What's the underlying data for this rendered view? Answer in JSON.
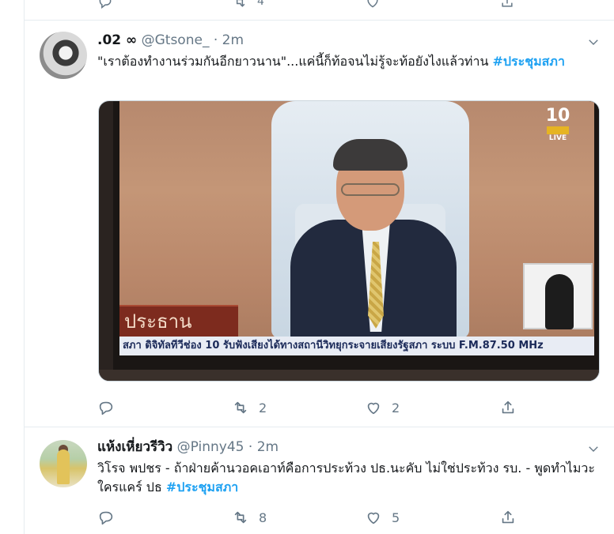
{
  "previous_tweet": {
    "retweet_count": "4"
  },
  "tweets": [
    {
      "display_name": ".02 ∞",
      "handle": "@Gtsone_",
      "separator": "·",
      "time": "2m",
      "text": "\"เราต้องทำงานร่วมกันอีกยาวนาน\"...แค่นี้ก็ท้อจนไม่รู้จะท้อยังไงแล้วท่าน ",
      "hashtag": "#ประชุมสภา",
      "media": {
        "nameplate": "ประธาน",
        "ticker": "สภา ดิจิทัลทีวีช่อง 10 รับฟังเสียงได้ทางสถานีวิทยุกระจายเสียงรัฐสภา ระบบ F.M.87.50 MHz",
        "channel_logo": "10",
        "channel_sub": "LIVE"
      },
      "reply_count": "",
      "retweet_count": "2",
      "like_count": "2"
    },
    {
      "display_name": "แห้งเหี่ยวรีวิว",
      "handle": "@Pinny45",
      "separator": "·",
      "time": "2m",
      "text": "วิโรจ พปชร - ถ้าฝ่ายค้านวอคเอาท์คือการประท้วง ปธ.นะคับ ไม่ใช่ประท้วง รบ. - พูดทำไมวะ ใครแคร์ ปธ ",
      "hashtag": "#ประชุมสภา",
      "reply_count": "",
      "retweet_count": "8",
      "like_count": "5"
    }
  ],
  "colors": {
    "link": "#1da1f2",
    "muted": "#657786",
    "text": "#14171a",
    "border": "#e6ecf0"
  }
}
